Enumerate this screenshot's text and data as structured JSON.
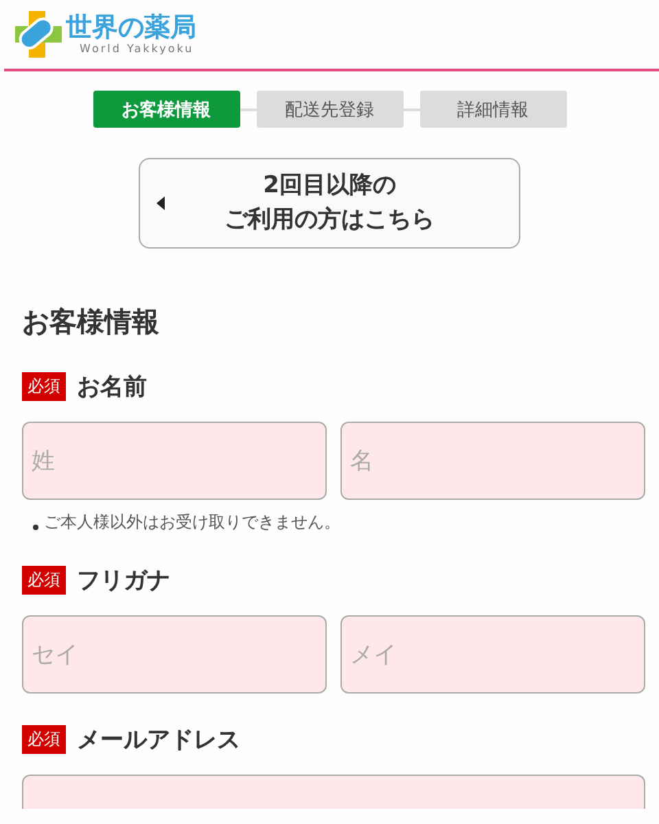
{
  "logo": {
    "title": "世界の薬局",
    "subtitle": "World Yakkyoku"
  },
  "steps": [
    {
      "label": "お客様情報",
      "selected": true
    },
    {
      "label": "配送先登録",
      "selected": false
    },
    {
      "label": "詳細情報",
      "selected": false
    }
  ],
  "returning_button": {
    "lines": [
      "2回目以降の",
      "ご利用の方はこちら"
    ]
  },
  "section_title": "お客様情報",
  "fields": [
    {
      "badge": "必須",
      "label": "お名前",
      "inputs": [
        {
          "kind": "text",
          "placeholder": "姓"
        },
        {
          "kind": "text",
          "placeholder": "名"
        }
      ],
      "note": "ご本人様以外はお受け取りできません。"
    },
    {
      "badge": "必須",
      "label": "フリガナ",
      "inputs": [
        {
          "kind": "text",
          "placeholder": "セイ"
        },
        {
          "kind": "text",
          "placeholder": "メイ"
        }
      ]
    },
    {
      "badge": "必須",
      "label": "メールアドレス",
      "inputs": [
        {
          "kind": "email"
        }
      ]
    }
  ]
}
